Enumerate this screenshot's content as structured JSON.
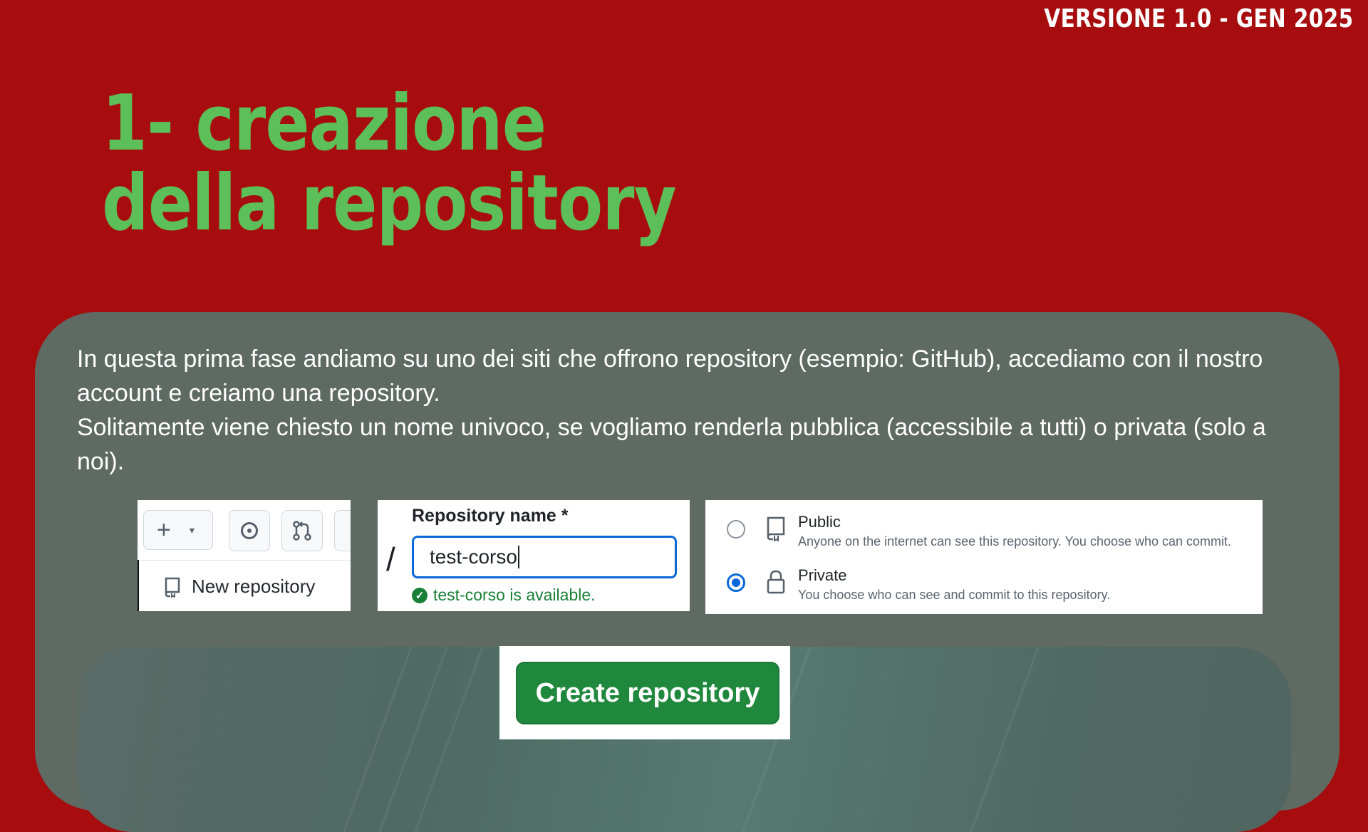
{
  "header": {
    "version": "VERSIONE 1.0 - GEN 2025",
    "title_line1": "1- creazione",
    "title_line2": "della repository"
  },
  "intro": {
    "p1": "In questa prima fase andiamo su uno dei siti che offrono repository (esempio: GitHub), accediamo con il nostro account e creiamo una repository.",
    "p2": "Solitamente viene chiesto un nome univoco, se vogliamo renderla pubblica (accessibile a tutti) o privata (solo a noi)."
  },
  "menu_panel": {
    "plus_symbol": "+",
    "caret": "▾",
    "new_repository": "New repository"
  },
  "name_panel": {
    "label": "Repository name *",
    "slash": "/",
    "value": "test-corso",
    "availability": "test-corso is available."
  },
  "visibility_panel": {
    "public_label": "Public",
    "public_desc": "Anyone on the internet can see this repository. You choose who can commit.",
    "private_label": "Private",
    "private_desc": "You choose who can see and commit to this repository.",
    "selected": "Private"
  },
  "create_button": {
    "label": "Create repository"
  },
  "colors": {
    "background": "#a70d0e",
    "title": "#5cbf5a",
    "card": "#5f6a63",
    "create_button": "#1f883d",
    "accent_blue": "#0969da"
  }
}
